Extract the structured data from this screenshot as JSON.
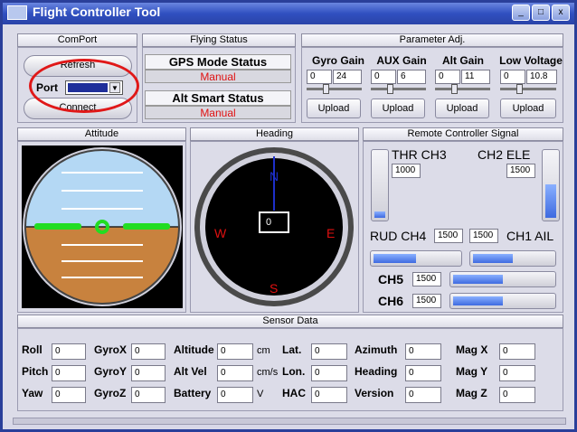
{
  "window": {
    "title": "Flight Controller Tool",
    "controls": [
      "_",
      "□",
      "x"
    ]
  },
  "comport": {
    "header": "ComPort",
    "refresh_label": "Refresh",
    "port_label": "Port",
    "port_value": "",
    "connect_label": "Connect"
  },
  "flying_status": {
    "header": "Flying Status",
    "gps_title": "GPS Mode Status",
    "gps_value": "Manual",
    "alt_title": "Alt Smart Status",
    "alt_value": "Manual"
  },
  "params": {
    "header": "Parameter Adj.",
    "upload_label": "Upload",
    "items": [
      {
        "label": "Gyro Gain",
        "min": "0",
        "value": "24"
      },
      {
        "label": "AUX Gain",
        "min": "0",
        "value": "6"
      },
      {
        "label": "Alt Gain",
        "min": "0",
        "value": "11"
      },
      {
        "label": "Low Voltage",
        "min": "0",
        "value": "10.8"
      }
    ]
  },
  "attitude": {
    "header": "Attitude"
  },
  "heading": {
    "header": "Heading",
    "value": "0",
    "n": "N",
    "s": "S",
    "e": "E",
    "w": "W"
  },
  "rc": {
    "header": "Remote Controller Signal",
    "thr_label": "THR CH3",
    "thr_value": "1000",
    "thr_level": 0.1,
    "ele_label": "CH2 ELE",
    "ele_value": "1500",
    "ele_level": 0.5,
    "rud_label": "RUD CH4",
    "rud_value": "1500",
    "rud_level": 0.5,
    "ail_label": "CH1 AIL",
    "ail_value": "1500",
    "ail_level": 0.5,
    "ch5_label": "CH5",
    "ch5_value": "1500",
    "ch5_level": 0.5,
    "ch6_label": "CH6",
    "ch6_value": "1500",
    "ch6_level": 0.5
  },
  "sensor": {
    "header": "Sensor Data",
    "roll": {
      "label": "Roll",
      "value": "0"
    },
    "pitch": {
      "label": "Pitch",
      "value": "0"
    },
    "yaw": {
      "label": "Yaw",
      "value": "0"
    },
    "gyrox": {
      "label": "GyroX",
      "value": "0"
    },
    "gyroy": {
      "label": "GyroY",
      "value": "0"
    },
    "gyroz": {
      "label": "GyroZ",
      "value": "0"
    },
    "altitude": {
      "label": "Altitude",
      "value": "0",
      "unit": "cm"
    },
    "altvel": {
      "label": "Alt Vel",
      "value": "0",
      "unit": "cm/s"
    },
    "battery": {
      "label": "Battery",
      "value": "0",
      "unit": "V"
    },
    "lat": {
      "label": "Lat.",
      "value": "0"
    },
    "lon": {
      "label": "Lon.",
      "value": "0"
    },
    "hac": {
      "label": "HAC",
      "value": "0"
    },
    "azimuth": {
      "label": "Azimuth",
      "value": "0"
    },
    "headingv": {
      "label": "Heading",
      "value": "0"
    },
    "version": {
      "label": "Version",
      "value": "0"
    },
    "magx": {
      "label": "Mag X",
      "value": "0"
    },
    "magy": {
      "label": "Mag Y",
      "value": "0"
    },
    "magz": {
      "label": "Mag Z",
      "value": "0"
    }
  },
  "colors": {
    "accent": "#2a44a8",
    "status_red": "#e01010",
    "fill_blue": "#3e6ae0",
    "horizon_green": "#22dd22"
  }
}
